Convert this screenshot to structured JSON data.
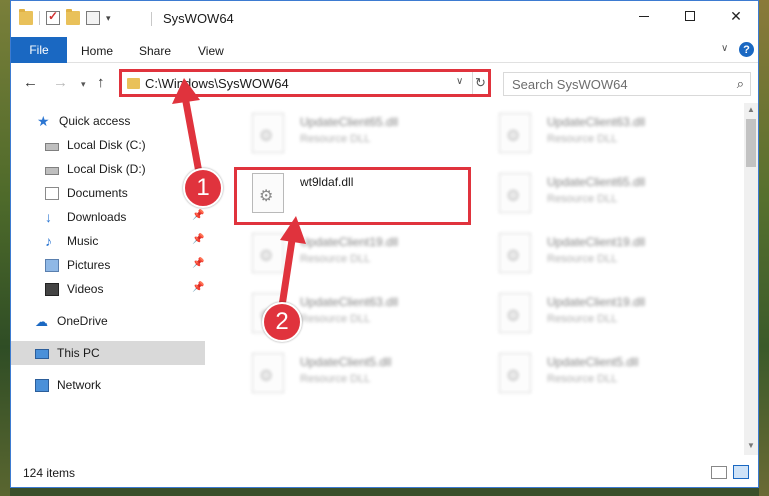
{
  "window": {
    "title": "SysWOW64"
  },
  "ribbon": {
    "tabs": [
      "File",
      "Home",
      "Share",
      "View"
    ],
    "help_label": "?"
  },
  "address": {
    "path": "C:\\Windows\\SysWOW64",
    "search_placeholder": "Search SysWOW64"
  },
  "sidebar": {
    "items": [
      {
        "label": "Quick access",
        "icon": "star-icon"
      },
      {
        "label": "Local Disk (C:)",
        "icon": "disk-icon"
      },
      {
        "label": "Local Disk (D:)",
        "icon": "disk-icon"
      },
      {
        "label": "Documents",
        "icon": "documents-icon",
        "pinned": true
      },
      {
        "label": "Downloads",
        "icon": "downloads-icon",
        "pinned": true
      },
      {
        "label": "Music",
        "icon": "music-icon",
        "pinned": true
      },
      {
        "label": "Pictures",
        "icon": "pictures-icon",
        "pinned": true
      },
      {
        "label": "Videos",
        "icon": "videos-icon",
        "pinned": true
      },
      {
        "label": "OneDrive",
        "icon": "onedrive-icon"
      },
      {
        "label": "This PC",
        "icon": "this-pc-icon",
        "selected": true
      },
      {
        "label": "Network",
        "icon": "network-icon"
      }
    ]
  },
  "files": {
    "highlighted": {
      "name": "wt9ldaf.dll"
    },
    "left_column": [
      {
        "name": "UpdateClient65.dll",
        "type": "Resource DLL"
      },
      {
        "name": "UpdateClient19.dll",
        "type": "Resource DLL"
      },
      {
        "name": "UpdateClient63.dll",
        "type": "Resource DLL"
      },
      {
        "name": "UpdateClient5.dll",
        "type": "Resource DLL"
      }
    ],
    "right_column": [
      {
        "name": "UpdateClient63.dll",
        "type": "Resource DLL"
      },
      {
        "name": "UpdateClient65.dll",
        "type": "Resource DLL"
      },
      {
        "name": "UpdateClient19.dll",
        "type": "Resource DLL"
      },
      {
        "name": "UpdateClient19.dll",
        "type": "Resource DLL"
      },
      {
        "name": "UpdateClient5.dll",
        "type": "Resource DLL"
      }
    ]
  },
  "status": {
    "item_count": "124 items"
  },
  "annotations": {
    "step1": "1",
    "step2": "2",
    "highlight_color": "#e0333d"
  }
}
